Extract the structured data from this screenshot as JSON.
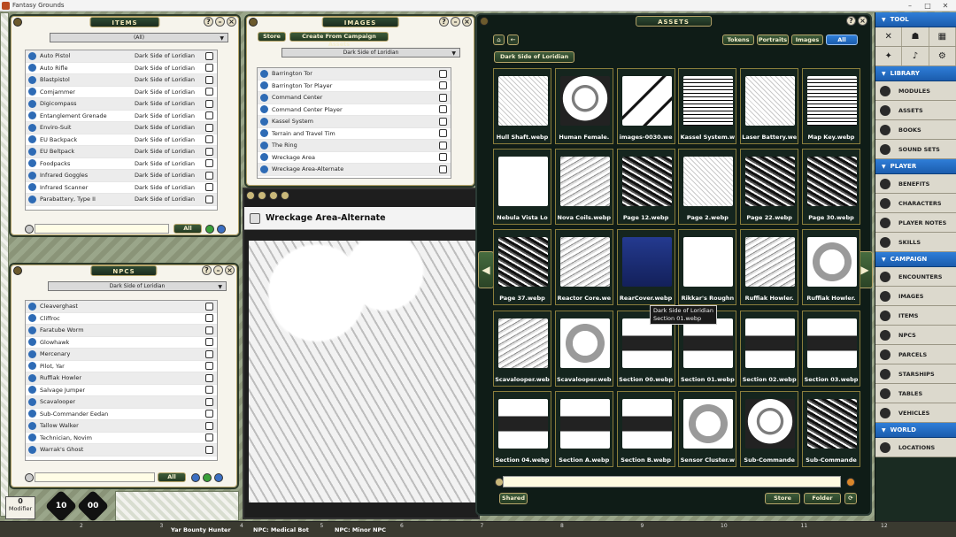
{
  "app": {
    "title": "Fantasy Grounds"
  },
  "items_panel": {
    "title": "ITEMS",
    "filter": "(All)",
    "rows": [
      {
        "name": "Auto Pistol",
        "source": "Dark Side of Loridian"
      },
      {
        "name": "Auto Rifle",
        "source": "Dark Side of Loridian"
      },
      {
        "name": "Blastpistol",
        "source": "Dark Side of Loridian"
      },
      {
        "name": "Comjammer",
        "source": "Dark Side of Loridian"
      },
      {
        "name": "Digicompass",
        "source": "Dark Side of Loridian"
      },
      {
        "name": "Entanglement Grenade",
        "source": "Dark Side of Loridian"
      },
      {
        "name": "Enviro-Suit",
        "source": "Dark Side of Loridian"
      },
      {
        "name": "EU Backpack",
        "source": "Dark Side of Loridian"
      },
      {
        "name": "EU Beltpack",
        "source": "Dark Side of Loridian"
      },
      {
        "name": "Foodpacks",
        "source": "Dark Side of Loridian"
      },
      {
        "name": "Infrared Goggles",
        "source": "Dark Side of Loridian"
      },
      {
        "name": "Infrared Scanner",
        "source": "Dark Side of Loridian"
      },
      {
        "name": "Parabattery, Type II",
        "source": "Dark Side of Loridian"
      }
    ],
    "all_label": "All"
  },
  "images_panel": {
    "title": "IMAGES",
    "store_label": "Store",
    "create_label": "Create From Campaign Assets",
    "filter": "Dark Side of Loridian",
    "rows": [
      {
        "name": "Barrington Tor"
      },
      {
        "name": "Barrington Tor Player"
      },
      {
        "name": "Command Center"
      },
      {
        "name": "Command Center Player"
      },
      {
        "name": "Kassel System"
      },
      {
        "name": "Terrain and Travel Tim"
      },
      {
        "name": "The Ring"
      },
      {
        "name": "Wreckage Area"
      },
      {
        "name": "Wreckage Area-Alternate"
      }
    ]
  },
  "npcs_panel": {
    "title": "NPCS",
    "filter": "Dark Side of Loridian",
    "rows": [
      {
        "name": "Cleaverghast"
      },
      {
        "name": "Cliffroc"
      },
      {
        "name": "Faratube Worm"
      },
      {
        "name": "Glowhawk"
      },
      {
        "name": "Mercenary"
      },
      {
        "name": "Pilot, Yar"
      },
      {
        "name": "Ruffiak Howler"
      },
      {
        "name": "Salvage Jumper"
      },
      {
        "name": "Scavalooper"
      },
      {
        "name": "Sub-Commander Eedan"
      },
      {
        "name": "Tallow Walker"
      },
      {
        "name": "Technician, Novim"
      },
      {
        "name": "Warrak's Ghost"
      }
    ],
    "all_label": "All"
  },
  "image_window": {
    "title": "Wreckage Area-Alternate"
  },
  "assets_panel": {
    "title": "ASSETS",
    "filters": [
      "Tokens",
      "Portraits",
      "Images",
      "All"
    ],
    "active_filter": "All",
    "breadcrumb": "Dark Side of Loridian",
    "tooltip": {
      "line1": "Dark Side of Loridian",
      "line2": "Section 01.webp"
    },
    "shared_label": "Shared",
    "store_label": "Store",
    "folder_label": "Folder",
    "assets": [
      {
        "name": "Hull Shaft.webp",
        "thumb": "sketch"
      },
      {
        "name": "Human Female.",
        "thumb": "face"
      },
      {
        "name": "images-0030.we",
        "thumb": "cube"
      },
      {
        "name": "Kassel System.w",
        "thumb": "page"
      },
      {
        "name": "Laser Battery.we",
        "thumb": "sketch"
      },
      {
        "name": "Map Key.webp",
        "thumb": "page"
      },
      {
        "name": "Nebula Vista Lo",
        "thumb": "title"
      },
      {
        "name": "Nova Coils.webp",
        "thumb": "grey"
      },
      {
        "name": "Page 12.webp",
        "thumb": "dark"
      },
      {
        "name": "Page 2.webp",
        "thumb": "sketch"
      },
      {
        "name": "Page 22.webp",
        "thumb": "dark"
      },
      {
        "name": "Page 30.webp",
        "thumb": "dark"
      },
      {
        "name": "Page 37.webp",
        "thumb": "dark"
      },
      {
        "name": "Reactor Core.we",
        "thumb": "grey"
      },
      {
        "name": "RearCover.webp",
        "thumb": "blue"
      },
      {
        "name": "Rikkar's Roughn",
        "thumb": "title"
      },
      {
        "name": "Ruffiak Howler.",
        "thumb": "grey"
      },
      {
        "name": "Ruffiak Howler.",
        "thumb": "round"
      },
      {
        "name": "Scavalooper.web",
        "thumb": "grey"
      },
      {
        "name": "Scavalooper.web",
        "thumb": "round"
      },
      {
        "name": "Section 00.webp",
        "thumb": "section"
      },
      {
        "name": "Section 01.webp",
        "thumb": "section"
      },
      {
        "name": "Section 02.webp",
        "thumb": "section"
      },
      {
        "name": "Section 03.webp",
        "thumb": "section"
      },
      {
        "name": "Section 04.webp",
        "thumb": "section"
      },
      {
        "name": "Section A.webp",
        "thumb": "section"
      },
      {
        "name": "Section B.webp",
        "thumb": "section"
      },
      {
        "name": "Sensor Cluster.w",
        "thumb": "round"
      },
      {
        "name": "Sub-Commande",
        "thumb": "face"
      },
      {
        "name": "Sub-Commande",
        "thumb": "dark"
      }
    ]
  },
  "sidebar": {
    "sections": [
      {
        "title": "TOOL",
        "items": []
      },
      {
        "title": "LIBRARY",
        "items": [
          "MODULES",
          "ASSETS",
          "BOOKS",
          "SOUND SETS"
        ]
      },
      {
        "title": "PLAYER",
        "items": [
          "BENEFITS",
          "CHARACTERS",
          "PLAYER NOTES",
          "SKILLS"
        ]
      },
      {
        "title": "CAMPAIGN",
        "items": [
          "ENCOUNTERS",
          "IMAGES",
          "ITEMS",
          "NPCS",
          "PARCELS",
          "STARSHIPS",
          "TABLES",
          "VEHICLES"
        ]
      },
      {
        "title": "WORLD",
        "items": [
          "LOCATIONS"
        ]
      }
    ]
  },
  "bottom_bar": {
    "tokens": [
      "Yar Bounty Hunter",
      "NPC: Medical Bot",
      "NPC: Minor NPC"
    ],
    "ticks": [
      "2",
      "3",
      "4",
      "5",
      "6",
      "7",
      "8",
      "9",
      "10",
      "11",
      "12"
    ]
  },
  "dice": {
    "modifier_value": "0",
    "modifier_label": "Modifier",
    "d10": "10",
    "d100": "00"
  }
}
